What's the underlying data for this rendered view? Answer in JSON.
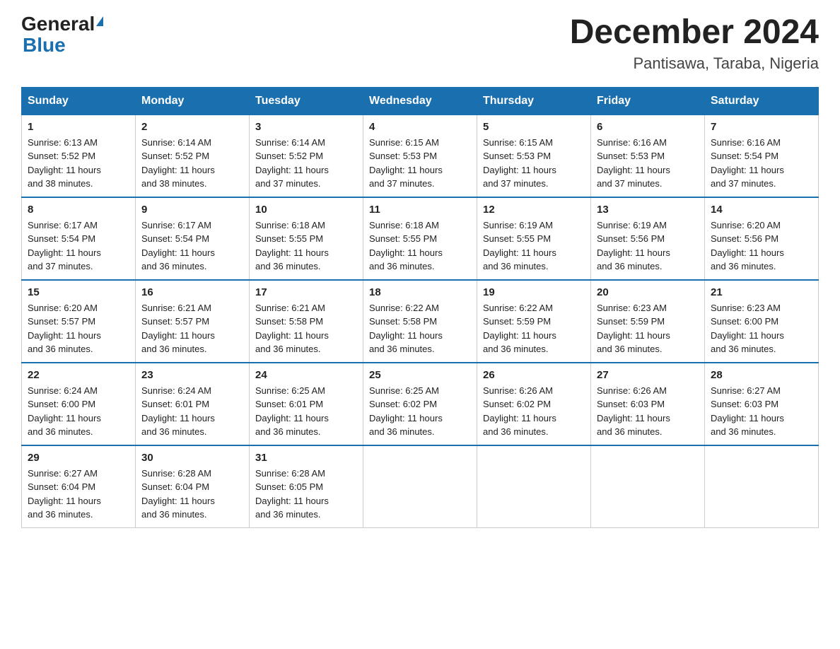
{
  "logo": {
    "general": "General",
    "blue": "Blue"
  },
  "title": "December 2024",
  "location": "Pantisawa, Taraba, Nigeria",
  "headers": [
    "Sunday",
    "Monday",
    "Tuesday",
    "Wednesday",
    "Thursday",
    "Friday",
    "Saturday"
  ],
  "weeks": [
    [
      {
        "day": "1",
        "sunrise": "6:13 AM",
        "sunset": "5:52 PM",
        "daylight": "11 hours and 38 minutes."
      },
      {
        "day": "2",
        "sunrise": "6:14 AM",
        "sunset": "5:52 PM",
        "daylight": "11 hours and 38 minutes."
      },
      {
        "day": "3",
        "sunrise": "6:14 AM",
        "sunset": "5:52 PM",
        "daylight": "11 hours and 37 minutes."
      },
      {
        "day": "4",
        "sunrise": "6:15 AM",
        "sunset": "5:53 PM",
        "daylight": "11 hours and 37 minutes."
      },
      {
        "day": "5",
        "sunrise": "6:15 AM",
        "sunset": "5:53 PM",
        "daylight": "11 hours and 37 minutes."
      },
      {
        "day": "6",
        "sunrise": "6:16 AM",
        "sunset": "5:53 PM",
        "daylight": "11 hours and 37 minutes."
      },
      {
        "day": "7",
        "sunrise": "6:16 AM",
        "sunset": "5:54 PM",
        "daylight": "11 hours and 37 minutes."
      }
    ],
    [
      {
        "day": "8",
        "sunrise": "6:17 AM",
        "sunset": "5:54 PM",
        "daylight": "11 hours and 37 minutes."
      },
      {
        "day": "9",
        "sunrise": "6:17 AM",
        "sunset": "5:54 PM",
        "daylight": "11 hours and 36 minutes."
      },
      {
        "day": "10",
        "sunrise": "6:18 AM",
        "sunset": "5:55 PM",
        "daylight": "11 hours and 36 minutes."
      },
      {
        "day": "11",
        "sunrise": "6:18 AM",
        "sunset": "5:55 PM",
        "daylight": "11 hours and 36 minutes."
      },
      {
        "day": "12",
        "sunrise": "6:19 AM",
        "sunset": "5:55 PM",
        "daylight": "11 hours and 36 minutes."
      },
      {
        "day": "13",
        "sunrise": "6:19 AM",
        "sunset": "5:56 PM",
        "daylight": "11 hours and 36 minutes."
      },
      {
        "day": "14",
        "sunrise": "6:20 AM",
        "sunset": "5:56 PM",
        "daylight": "11 hours and 36 minutes."
      }
    ],
    [
      {
        "day": "15",
        "sunrise": "6:20 AM",
        "sunset": "5:57 PM",
        "daylight": "11 hours and 36 minutes."
      },
      {
        "day": "16",
        "sunrise": "6:21 AM",
        "sunset": "5:57 PM",
        "daylight": "11 hours and 36 minutes."
      },
      {
        "day": "17",
        "sunrise": "6:21 AM",
        "sunset": "5:58 PM",
        "daylight": "11 hours and 36 minutes."
      },
      {
        "day": "18",
        "sunrise": "6:22 AM",
        "sunset": "5:58 PM",
        "daylight": "11 hours and 36 minutes."
      },
      {
        "day": "19",
        "sunrise": "6:22 AM",
        "sunset": "5:59 PM",
        "daylight": "11 hours and 36 minutes."
      },
      {
        "day": "20",
        "sunrise": "6:23 AM",
        "sunset": "5:59 PM",
        "daylight": "11 hours and 36 minutes."
      },
      {
        "day": "21",
        "sunrise": "6:23 AM",
        "sunset": "6:00 PM",
        "daylight": "11 hours and 36 minutes."
      }
    ],
    [
      {
        "day": "22",
        "sunrise": "6:24 AM",
        "sunset": "6:00 PM",
        "daylight": "11 hours and 36 minutes."
      },
      {
        "day": "23",
        "sunrise": "6:24 AM",
        "sunset": "6:01 PM",
        "daylight": "11 hours and 36 minutes."
      },
      {
        "day": "24",
        "sunrise": "6:25 AM",
        "sunset": "6:01 PM",
        "daylight": "11 hours and 36 minutes."
      },
      {
        "day": "25",
        "sunrise": "6:25 AM",
        "sunset": "6:02 PM",
        "daylight": "11 hours and 36 minutes."
      },
      {
        "day": "26",
        "sunrise": "6:26 AM",
        "sunset": "6:02 PM",
        "daylight": "11 hours and 36 minutes."
      },
      {
        "day": "27",
        "sunrise": "6:26 AM",
        "sunset": "6:03 PM",
        "daylight": "11 hours and 36 minutes."
      },
      {
        "day": "28",
        "sunrise": "6:27 AM",
        "sunset": "6:03 PM",
        "daylight": "11 hours and 36 minutes."
      }
    ],
    [
      {
        "day": "29",
        "sunrise": "6:27 AM",
        "sunset": "6:04 PM",
        "daylight": "11 hours and 36 minutes."
      },
      {
        "day": "30",
        "sunrise": "6:28 AM",
        "sunset": "6:04 PM",
        "daylight": "11 hours and 36 minutes."
      },
      {
        "day": "31",
        "sunrise": "6:28 AM",
        "sunset": "6:05 PM",
        "daylight": "11 hours and 36 minutes."
      },
      null,
      null,
      null,
      null
    ]
  ],
  "labels": {
    "sunrise": "Sunrise:",
    "sunset": "Sunset:",
    "daylight": "Daylight:"
  }
}
